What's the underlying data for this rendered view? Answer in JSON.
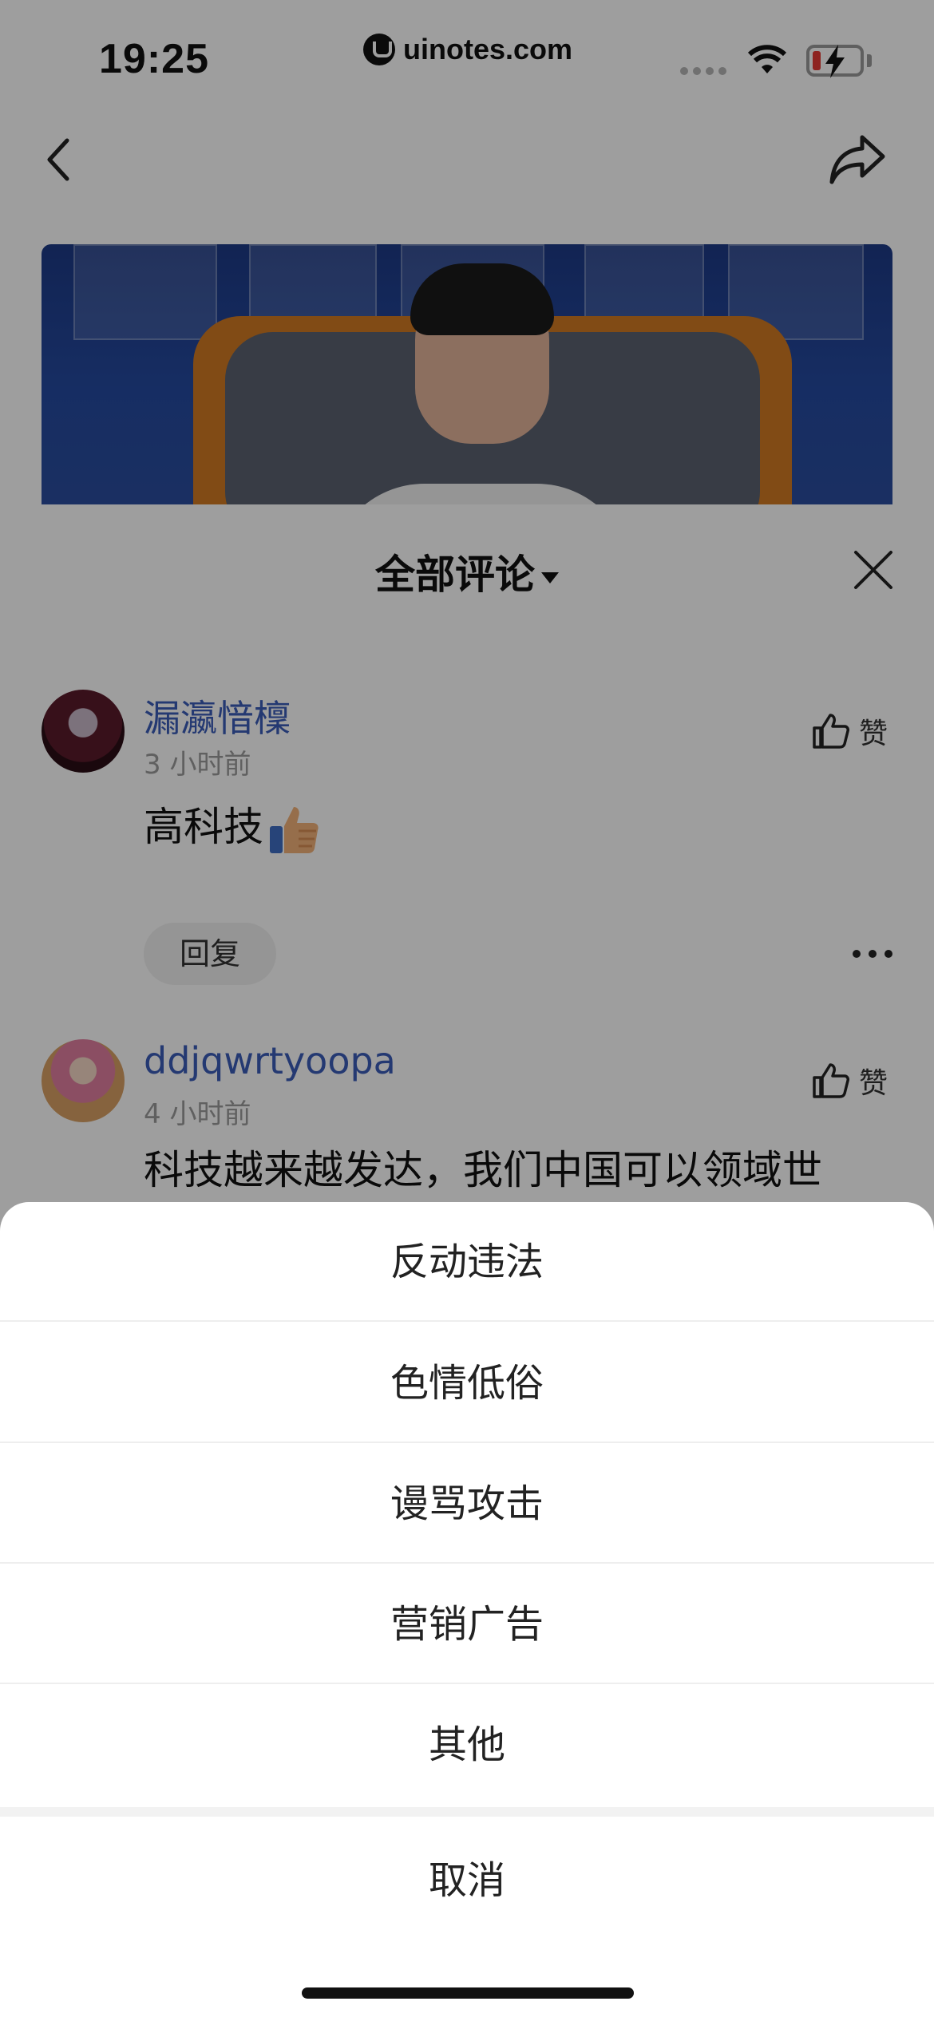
{
  "status_bar": {
    "time": "19:25",
    "url": "uinotes.com",
    "battery_color": "#e53935"
  },
  "nav": {
    "back_icon": "chevron-left-icon",
    "share_icon": "share-icon"
  },
  "comments_panel": {
    "title": "全部评论",
    "close_icon": "close-icon",
    "comments": [
      {
        "author": "漏瀛愔檁",
        "time": "3 小时前",
        "text": "高科技",
        "emoji": "thumbs-up-emoji",
        "like_label": "赞",
        "reply_label": "回复"
      },
      {
        "author": "ddjqwrtyoopa",
        "time": "4 小时前",
        "text": "科技越来越发达，我们中国可以领域世",
        "like_label": "赞"
      }
    ]
  },
  "action_sheet": {
    "options": [
      "反动违法",
      "色情低俗",
      "谩骂攻击",
      "营销广告",
      "其他"
    ],
    "cancel_label": "取消"
  },
  "colors": {
    "link_blue": "#3b5cb8",
    "overlay": "rgba(0,0,0,0.38)"
  }
}
